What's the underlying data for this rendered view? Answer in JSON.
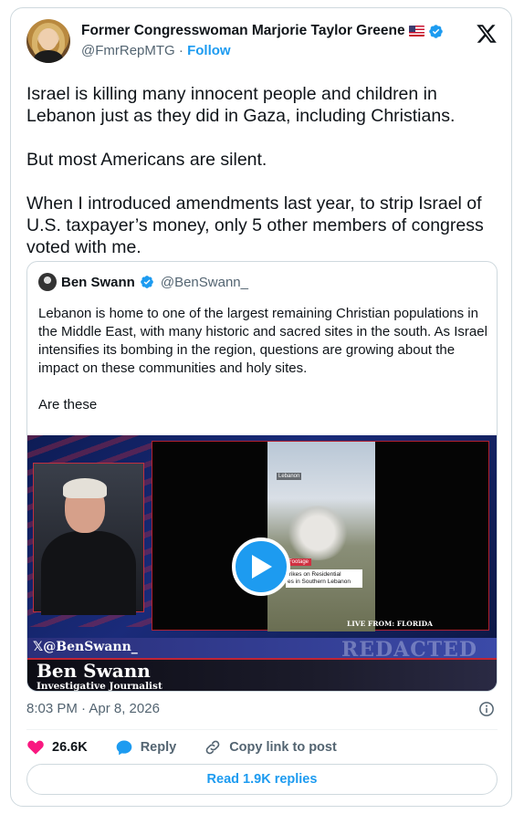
{
  "post": {
    "author": {
      "display_name": "Former Congresswoman Marjorie Taylor Greene",
      "flag": "us-flag",
      "verified": true,
      "handle": "@FmrRepMTG",
      "separator": "·",
      "follow_label": "Follow"
    },
    "text": "Israel is killing many innocent people and children in Lebanon just as they did in Gaza, including Christians.\n\nBut most Americans are silent.\n\nWhen I introduced amendments last year, to strip Israel of U.S. taxpayer’s money, only 5 other members of congress voted with me.",
    "timestamp": "8:03 PM · Apr 8, 2026",
    "actions": {
      "like_count": "26.6K",
      "reply_label": "Reply",
      "copy_link_label": "Copy link to post"
    },
    "read_replies_label": "Read 1.9K replies"
  },
  "quoted_post": {
    "author": {
      "display_name": "Ben Swann",
      "verified": true,
      "handle": "@BenSwann_"
    },
    "text": "Lebanon is home to one of the largest remaining Christian populations in the Middle East, with many historic and sacred sites in the south. As Israel intensifies its bombing in the region, questions are growing about the impact on these communities and holy sites.\n\nAre these",
    "video": {
      "clip_location": "Lebanon",
      "clip_tag": "Footage",
      "clip_caption": "trikes on Residential\nes in Southern Lebanon",
      "live_from": "LIVE FROM:  FLORIDA",
      "x_handle": "@BenSwann_",
      "watermark": "REDACTED",
      "host_name": "Ben Swann",
      "host_title": "Investigative Journalist"
    }
  },
  "colors": {
    "accent": "#1d9bf0",
    "like": "#f91880",
    "text_primary": "#0f1419",
    "text_secondary": "#536471",
    "border": "#cfd9de"
  },
  "icons": {
    "close": "x-logo-icon",
    "verified": "verified-badge-icon",
    "play": "play-icon",
    "info": "info-icon",
    "like": "heart-icon",
    "reply": "speech-bubble-icon",
    "copy": "link-icon"
  }
}
